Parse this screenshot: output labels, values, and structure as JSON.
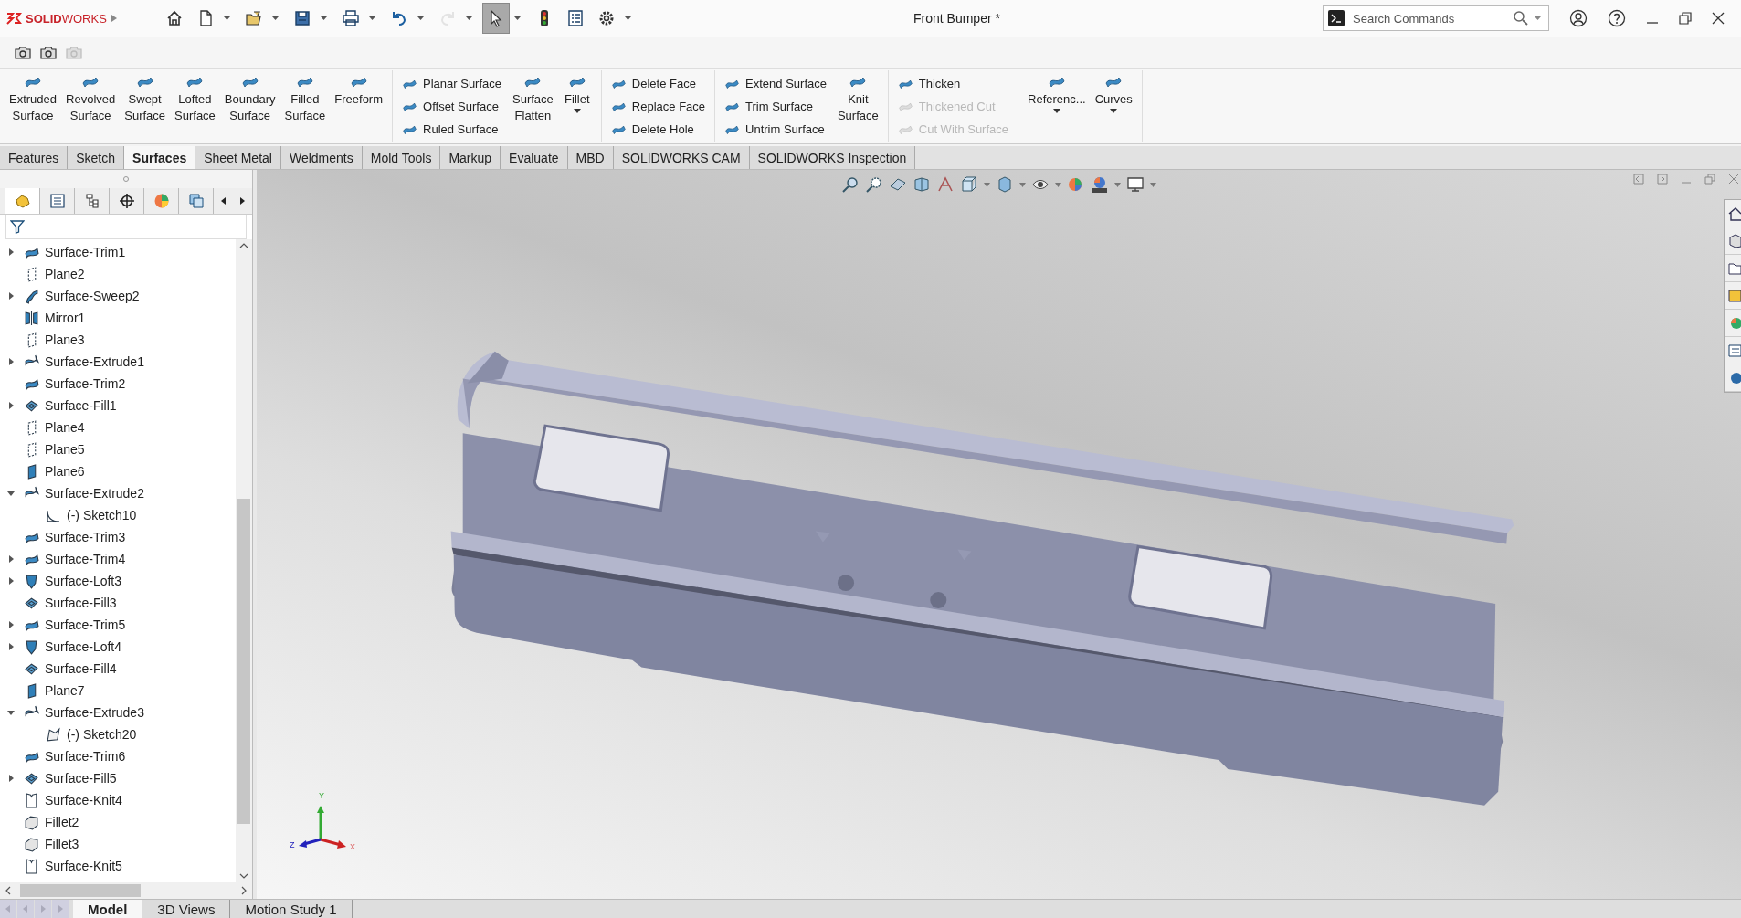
{
  "title_bar": {
    "logo": "**SOLID**WORKS",
    "document_title": "Front Bumper *",
    "search": {
      "placeholder": "Search Commands"
    }
  },
  "quick_access": [
    {
      "selected": false,
      "disabled": false
    },
    {
      "selected": false,
      "disabled": false
    },
    {
      "selected": false,
      "disabled": false
    },
    {
      "selected": false,
      "disabled": false
    },
    {
      "selected": false,
      "disabled": false
    },
    {
      "selected": false,
      "disabled": false
    },
    {
      "selected": false,
      "disabled": true
    },
    {
      "selected": true,
      "disabled": false
    },
    {
      "selected": false,
      "disabled": false
    },
    {
      "selected": false,
      "disabled": false
    },
    {
      "selected": false,
      "disabled": false
    }
  ],
  "capture_tools": [
    {
      "disabled": false
    },
    {
      "disabled": false
    },
    {
      "disabled": true
    }
  ],
  "ribbon": {
    "sections": [
      {
        "blocks": [
          {
            "kind": "large",
            "items": [
              {
                "label": "Extruded Surface",
                "disabled": false,
                "dropdown": false
              },
              {
                "label": "Revolved Surface",
                "disabled": false,
                "dropdown": false
              },
              {
                "label": "Swept Surface",
                "disabled": false,
                "dropdown": false
              },
              {
                "label": "Lofted Surface",
                "disabled": false,
                "dropdown": false
              },
              {
                "label": "Boundary Surface",
                "disabled": false,
                "dropdown": false
              },
              {
                "label": "Filled Surface",
                "disabled": false,
                "dropdown": false
              },
              {
                "label": "Freeform",
                "disabled": false,
                "dropdown": false
              }
            ]
          }
        ]
      },
      {
        "blocks": [
          {
            "kind": "stack",
            "items": [
              {
                "label": "Planar Surface",
                "disabled": false,
                "dropdown": false
              },
              {
                "label": "Offset Surface",
                "disabled": false,
                "dropdown": false
              },
              {
                "label": "Ruled Surface",
                "disabled": false,
                "dropdown": false
              }
            ]
          },
          {
            "kind": "large",
            "items": [
              {
                "label": "Surface Flatten",
                "disabled": false,
                "dropdown": false
              },
              {
                "label": "Fillet",
                "disabled": false,
                "dropdown": true
              }
            ]
          }
        ]
      },
      {
        "blocks": [
          {
            "kind": "stack",
            "items": [
              {
                "label": "Delete Face",
                "disabled": false,
                "dropdown": false
              },
              {
                "label": "Replace Face",
                "disabled": false,
                "dropdown": false
              },
              {
                "label": "Delete Hole",
                "disabled": false,
                "dropdown": false
              }
            ]
          }
        ]
      },
      {
        "blocks": [
          {
            "kind": "stack",
            "items": [
              {
                "label": "Extend Surface",
                "disabled": false,
                "dropdown": false
              },
              {
                "label": "Trim Surface",
                "disabled": false,
                "dropdown": false
              },
              {
                "label": "Untrim Surface",
                "disabled": false,
                "dropdown": false
              }
            ]
          },
          {
            "kind": "large",
            "items": [
              {
                "label": "Knit Surface",
                "disabled": false,
                "dropdown": false
              }
            ]
          }
        ]
      },
      {
        "blocks": [
          {
            "kind": "stack",
            "items": [
              {
                "label": "Thicken",
                "disabled": false,
                "dropdown": false
              },
              {
                "label": "Thickened Cut",
                "disabled": true,
                "dropdown": false
              },
              {
                "label": "Cut With Surface",
                "disabled": true,
                "dropdown": false
              }
            ]
          }
        ]
      },
      {
        "blocks": [
          {
            "kind": "large",
            "items": [
              {
                "label": "Referenc...",
                "disabled": false,
                "dropdown": true
              },
              {
                "label": "Curves",
                "disabled": false,
                "dropdown": true
              }
            ]
          }
        ]
      }
    ]
  },
  "tabs": [
    {
      "label": "Features",
      "selected": false
    },
    {
      "label": "Sketch",
      "selected": false
    },
    {
      "label": "Surfaces",
      "selected": true
    },
    {
      "label": "Sheet Metal",
      "selected": false
    },
    {
      "label": "Weldments",
      "selected": false
    },
    {
      "label": "Mold Tools",
      "selected": false
    },
    {
      "label": "Markup",
      "selected": false
    },
    {
      "label": "Evaluate",
      "selected": false
    },
    {
      "label": "MBD",
      "selected": false
    },
    {
      "label": "SOLIDWORKS CAM",
      "selected": false
    },
    {
      "label": "SOLIDWORKS Inspection",
      "selected": false
    }
  ],
  "feature_tree": {
    "items": [
      {
        "label": "Surface-Trim1",
        "kind": "trim",
        "expanded": false
      },
      {
        "label": "Plane2",
        "kind": "plane"
      },
      {
        "label": "Surface-Sweep2",
        "kind": "sweep",
        "expanded": false
      },
      {
        "label": "Mirror1",
        "kind": "mirror"
      },
      {
        "label": "Plane3",
        "kind": "plane"
      },
      {
        "label": "Surface-Extrude1",
        "kind": "extrude",
        "expanded": false
      },
      {
        "label": "Surface-Trim2",
        "kind": "trim"
      },
      {
        "label": "Surface-Fill1",
        "kind": "fill",
        "expanded": false
      },
      {
        "label": "Plane4",
        "kind": "plane"
      },
      {
        "label": "Plane5",
        "kind": "plane"
      },
      {
        "label": "Plane6",
        "kind": "plane-solid"
      },
      {
        "label": "Surface-Extrude2",
        "kind": "extrude",
        "expanded": true,
        "children": [
          {
            "label": "(-) Sketch10",
            "kind": "sketch"
          }
        ]
      },
      {
        "label": "Surface-Trim3",
        "kind": "trim"
      },
      {
        "label": "Surface-Trim4",
        "kind": "trim",
        "expanded": false
      },
      {
        "label": "Surface-Loft3",
        "kind": "loft",
        "expanded": false
      },
      {
        "label": "Surface-Fill3",
        "kind": "fill"
      },
      {
        "label": "Surface-Trim5",
        "kind": "trim",
        "expanded": false
      },
      {
        "label": "Surface-Loft4",
        "kind": "loft",
        "expanded": false
      },
      {
        "label": "Surface-Fill4",
        "kind": "fill"
      },
      {
        "label": "Plane7",
        "kind": "plane-solid"
      },
      {
        "label": "Surface-Extrude3",
        "kind": "extrude",
        "expanded": true,
        "children": [
          {
            "label": "(-) Sketch20",
            "kind": "sketch3d"
          }
        ]
      },
      {
        "label": "Surface-Trim6",
        "kind": "trim"
      },
      {
        "label": "Surface-Fill5",
        "kind": "fill",
        "expanded": false
      },
      {
        "label": "Surface-Knit4",
        "kind": "knit"
      },
      {
        "label": "Fillet2",
        "kind": "fillet"
      },
      {
        "label": "Fillet3",
        "kind": "fillet"
      },
      {
        "label": "Surface-Knit5",
        "kind": "knit"
      }
    ]
  },
  "triad": {
    "x": "X",
    "y": "Y",
    "z": "Z"
  },
  "panel_tabs": [
    {
      "selected": true
    },
    {
      "selected": false
    },
    {
      "selected": false
    },
    {
      "selected": false
    },
    {
      "selected": false
    },
    {
      "selected": false
    }
  ],
  "bottom_tabs": [
    {
      "label": "Model",
      "selected": true
    },
    {
      "label": "3D Views",
      "selected": false
    },
    {
      "label": "Motion Study 1",
      "selected": false
    }
  ]
}
